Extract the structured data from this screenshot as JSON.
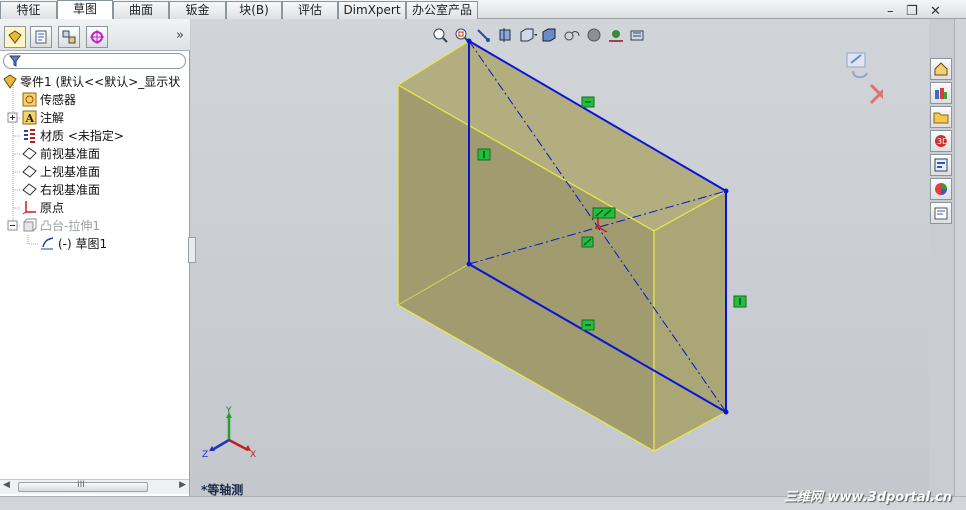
{
  "tabs": [
    "特征",
    "草图",
    "曲面",
    "钣金",
    "块(B)",
    "评估",
    "DimXpert",
    "办公室产品"
  ],
  "active_tab": "草图",
  "feature_tree": {
    "root": "零件1 (默认<<默认>_显示状",
    "items": [
      {
        "label": "传感器"
      },
      {
        "label": "注解"
      },
      {
        "label": "材质 <未指定>"
      },
      {
        "label": "前视基准面"
      },
      {
        "label": "上视基准面"
      },
      {
        "label": "右视基准面"
      },
      {
        "label": "原点"
      },
      {
        "label": "凸台-拉伸1"
      },
      {
        "label": "(-) 草图1"
      }
    ]
  },
  "scroll_label": "III",
  "view_label": "*等轴测",
  "axis": {
    "x": "X",
    "y": "Y",
    "z": "Z"
  },
  "watermark": "三维网 www.3dportal.cn",
  "colors": {
    "sketch": "#0a14d6",
    "body_fill": "#a8a474",
    "body_edge": "#e8e84a",
    "relation": "#22c03a",
    "accent": "#1b3f8a"
  }
}
